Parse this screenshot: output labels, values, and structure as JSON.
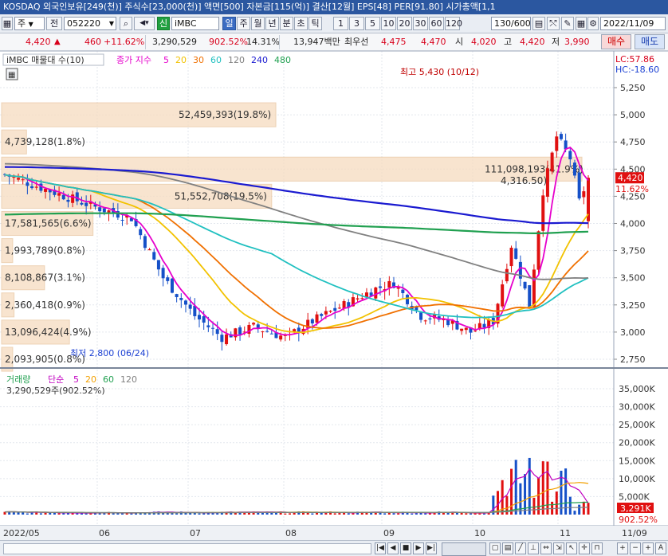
{
  "title": "KOSDAQ 외국인보유[249(천)] 주식수[23,000(천)] 액면[500] 자본금[115(억)] 결산[12월] EPS[48] PER[91.80] 시가총액[1,1",
  "toolbar": {
    "market": "주",
    "prefix": "전",
    "code": "052220",
    "kind": "신",
    "name": "iMBC",
    "periods": [
      "일",
      "주",
      "월",
      "년",
      "분",
      "초",
      "틱"
    ],
    "active_period": "일",
    "intervals": [
      "1",
      "3",
      "5",
      "10",
      "20",
      "30",
      "60",
      "120"
    ],
    "count": "130",
    "count_total": "/600",
    "date": "2022/11/09"
  },
  "quote": {
    "price": "4,420",
    "arrow": "▲",
    "change": "460",
    "change_pct": "+11.62%",
    "volume": "3,290,529",
    "vol_ratio": "902.52%",
    "turnover": "14.31%",
    "amount": "13,947백만",
    "best_label": "최우선",
    "best_ask": "4,475",
    "best_bid": "4,470",
    "open_label": "시",
    "open": "4,020",
    "high_label": "고",
    "high": "4,420",
    "low_label": "저",
    "low": "3,990",
    "buy": "매수",
    "sell": "매도"
  },
  "price_panel": {
    "legend_name": "iMBC 매물대 수(10)",
    "ma_label": "종가 지수",
    "ma_periods": [
      "5",
      "20",
      "30",
      "60",
      "120",
      "240",
      "480"
    ],
    "ma_colors": [
      "#e600cc",
      "#f2c200",
      "#f07000",
      "#20c0c0",
      "#808080",
      "#1a1ad0",
      "#20a050"
    ],
    "lc": "LC:57.86",
    "hc": "HC:-18.60",
    "high_note": "최고 5,430 (10/12)",
    "low_note": "최저 2,800 (06/24)",
    "current_price": "4,420",
    "current_pct": "11.62%",
    "y_ticks": [
      "5,250",
      "5,000",
      "4,750",
      "4,500",
      "4,250",
      "4,000",
      "3,750",
      "3,500",
      "3,250",
      "3,000",
      "2,750"
    ],
    "volume_profile": [
      "52,459,393(19.8%)",
      "4,739,128(1.8%)",
      "111,098,193(41.9%)",
      "51,552,708(19.5%)",
      "17,581,565(6.6%)",
      "1,993,789(0.8%)",
      "8,108,867(3.1%)",
      "2,360,418(0.9%)",
      "13,096,424(4.9%)",
      "2,093,905(0.8%)"
    ],
    "overlay_fragment": "4,316.50)"
  },
  "volume_panel": {
    "legend": "거래량",
    "ma_label": "단순",
    "ma_periods": [
      "5",
      "20",
      "60",
      "120"
    ],
    "ma_colors": [
      "#c000c0",
      "#f2a000",
      "#20a050",
      "#808080"
    ],
    "current": "3,290,529주(902.52%)",
    "y_ticks": [
      "35,000K",
      "30,000K",
      "25,000K",
      "20,000K",
      "15,000K",
      "10,000K",
      "5,000K"
    ],
    "current_label": "3,291K",
    "current_pct": "902.52%"
  },
  "x_axis": [
    "2022/05",
    "06",
    "07",
    "08",
    "09",
    "10",
    "11",
    "11/09"
  ],
  "icons": [
    "search-icon",
    "gear-icon",
    "grid-icon",
    "nav-first-icon",
    "nav-prev-icon",
    "stop-icon",
    "nav-next-icon",
    "zoom-in-icon",
    "zoom-out-icon"
  ]
}
